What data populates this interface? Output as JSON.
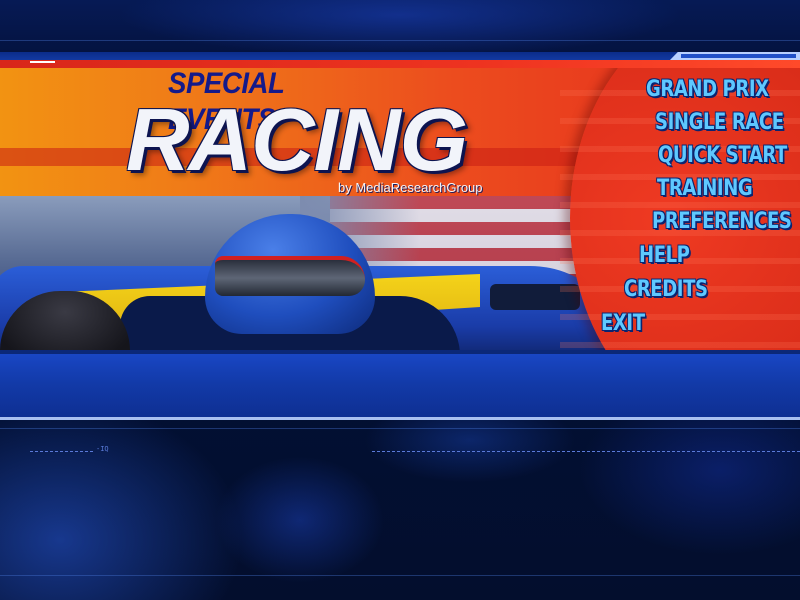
{
  "title": {
    "subtitle": "SPECIAL EVENTS",
    "main": "RACING",
    "byline": "by MediaResearchGroup"
  },
  "menu": {
    "items": [
      {
        "label": "GRAND PRIX"
      },
      {
        "label": "SINGLE RACE"
      },
      {
        "label": "QUICK START"
      },
      {
        "label": "TRAINING"
      },
      {
        "label": "PREFERENCES"
      },
      {
        "label": "HELP"
      },
      {
        "label": "CREDITS"
      },
      {
        "label": "EXIT"
      }
    ]
  },
  "footer": {
    "mark": "-IQ"
  },
  "colors": {
    "menu_text": "#5ec8ff",
    "banner_red": "#e0301c",
    "banner_orange": "#f29312",
    "title_blue": "#141a8a",
    "bottom_bar_blue": "#123aa8",
    "background": "#021034"
  }
}
